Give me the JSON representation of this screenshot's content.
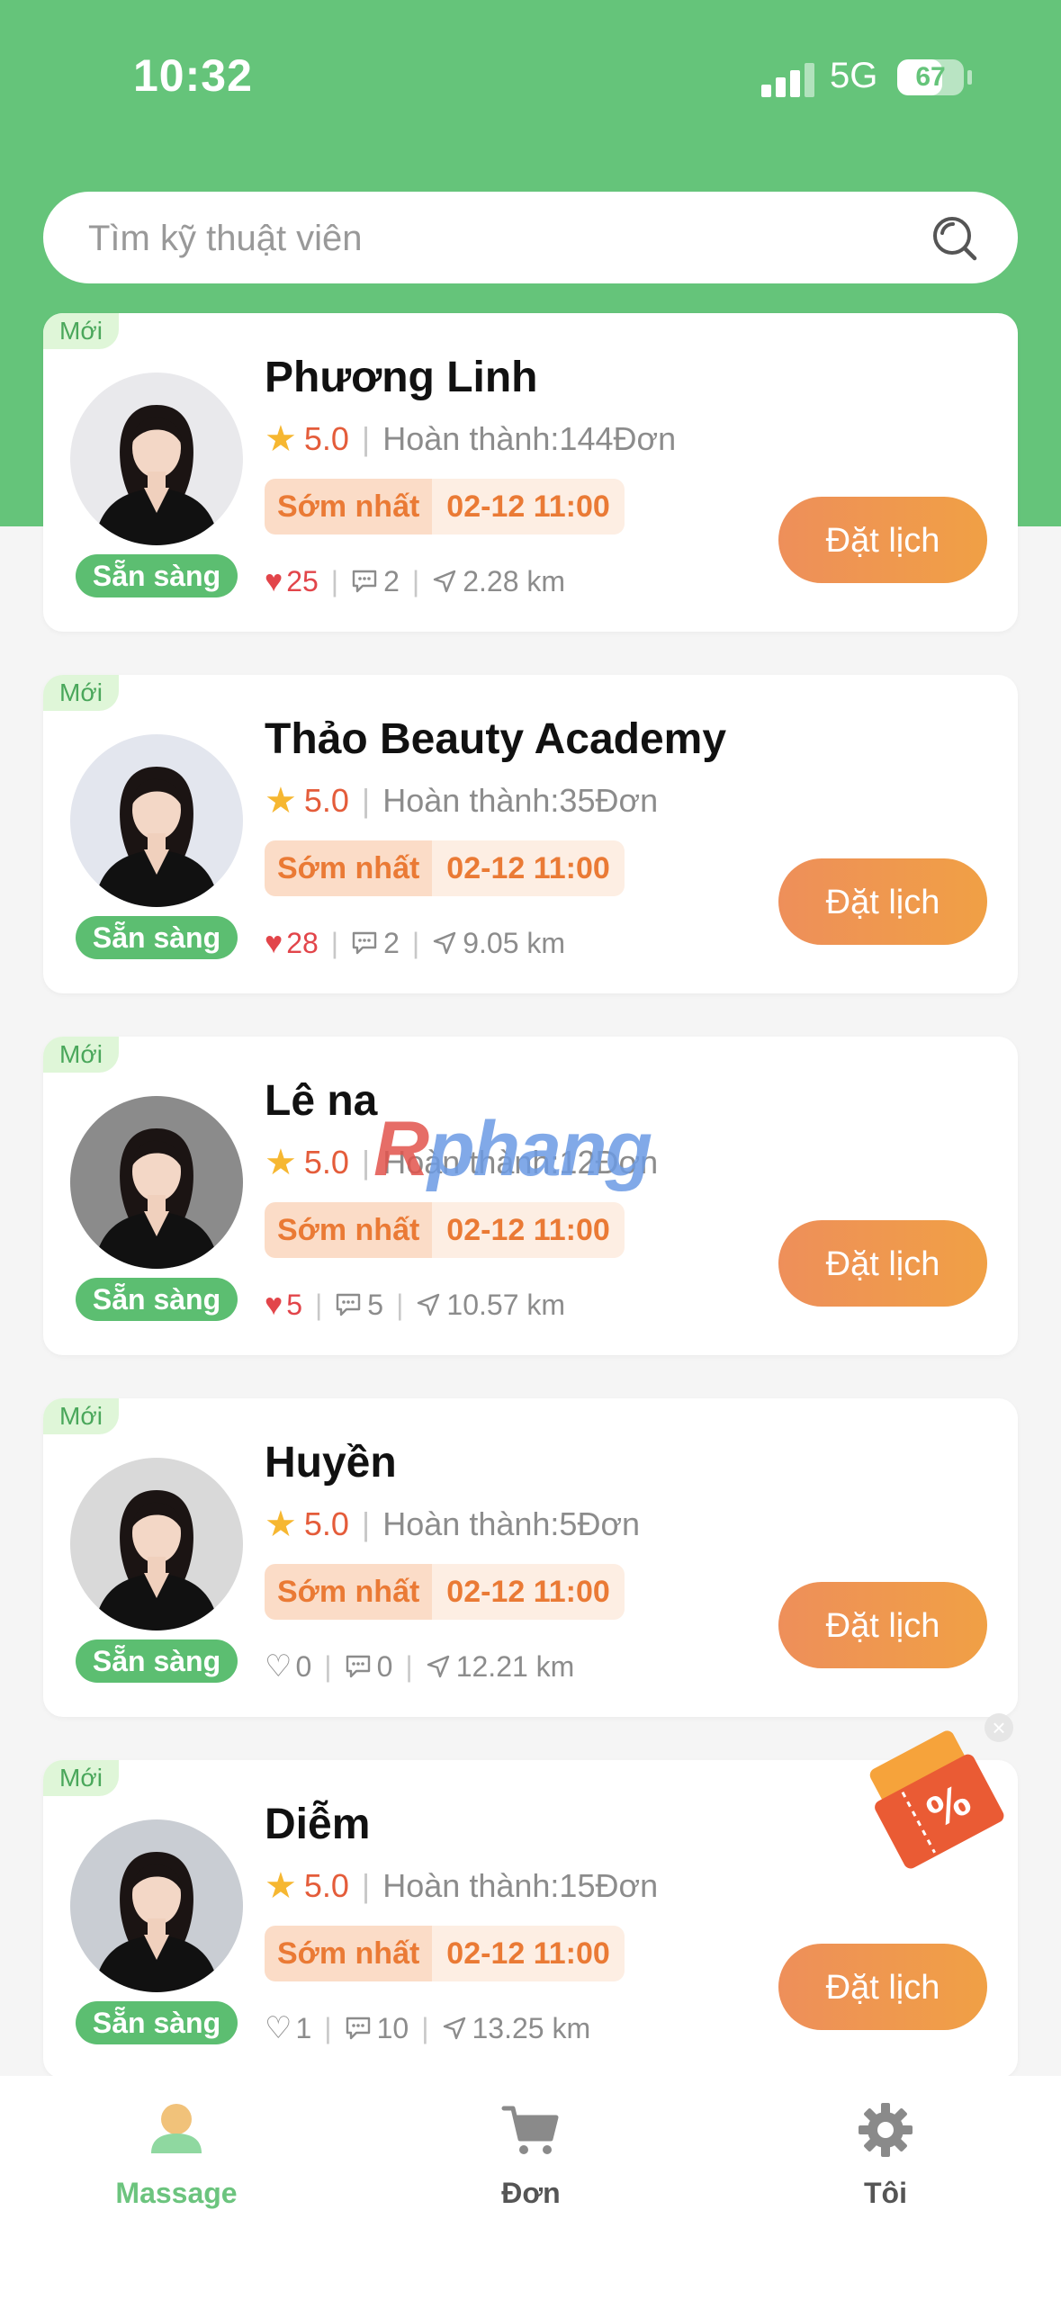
{
  "status_bar": {
    "time": "10:32",
    "network": "5G",
    "battery": "67",
    "battery_level": 0.67
  },
  "search": {
    "placeholder": "Tìm kỹ thuật viên"
  },
  "technicians": [
    {
      "tag": "Mới",
      "status": "Sẵn sàng",
      "name": "Phương Linh",
      "rating": "5.0",
      "completed": "Hoàn thành:144Đơn",
      "slot_label": "Sớm nhất",
      "slot_time": "02-12 11:00",
      "likes": "25",
      "liked": true,
      "comments": "2",
      "distance": "2.28 km",
      "button": "Đặt lịch"
    },
    {
      "tag": "Mới",
      "status": "Sẵn sàng",
      "name": "Thảo Beauty Academy",
      "rating": "5.0",
      "completed": "Hoàn thành:35Đơn",
      "slot_label": "Sớm nhất",
      "slot_time": "02-12 11:00",
      "likes": "28",
      "liked": true,
      "comments": "2",
      "distance": "9.05 km",
      "button": "Đặt lịch"
    },
    {
      "tag": "Mới",
      "status": "Sẵn sàng",
      "name": "Lê na",
      "rating": "5.0",
      "completed": "Hoàn thành:12Đơn",
      "slot_label": "Sớm nhất",
      "slot_time": "02-12 11:00",
      "likes": "5",
      "liked": true,
      "comments": "5",
      "distance": "10.57 km",
      "button": "Đặt lịch"
    },
    {
      "tag": "Mới",
      "status": "Sẵn sàng",
      "name": "Huyền",
      "rating": "5.0",
      "completed": "Hoàn thành:5Đơn",
      "slot_label": "Sớm nhất",
      "slot_time": "02-12 11:00",
      "likes": "0",
      "liked": false,
      "comments": "0",
      "distance": "12.21 km",
      "button": "Đặt lịch"
    },
    {
      "tag": "Mới",
      "status": "Sẵn sàng",
      "name": "Diễm",
      "rating": "5.0",
      "completed": "Hoàn thành:15Đơn",
      "slot_label": "Sớm nhất",
      "slot_time": "02-12 11:00",
      "likes": "1",
      "liked": false,
      "comments": "10",
      "distance": "13.25 km",
      "button": "Đặt lịch"
    }
  ],
  "promo": {
    "icon": "discount-coupon-icon",
    "symbol": "%",
    "close": "×"
  },
  "watermark": {
    "part1": "R",
    "part2": "phang"
  },
  "tabbar": {
    "tabs": [
      {
        "label": "Massage",
        "icon": "person-icon",
        "active": true
      },
      {
        "label": "Đơn",
        "icon": "cart-icon",
        "active": false
      },
      {
        "label": "Tôi",
        "icon": "gear-icon",
        "active": false
      }
    ]
  },
  "colors": {
    "primary_green": "#65c47a",
    "accent_orange": "#ee8f5a",
    "rating_red": "#e45c3a",
    "like_red": "#e2454a"
  }
}
